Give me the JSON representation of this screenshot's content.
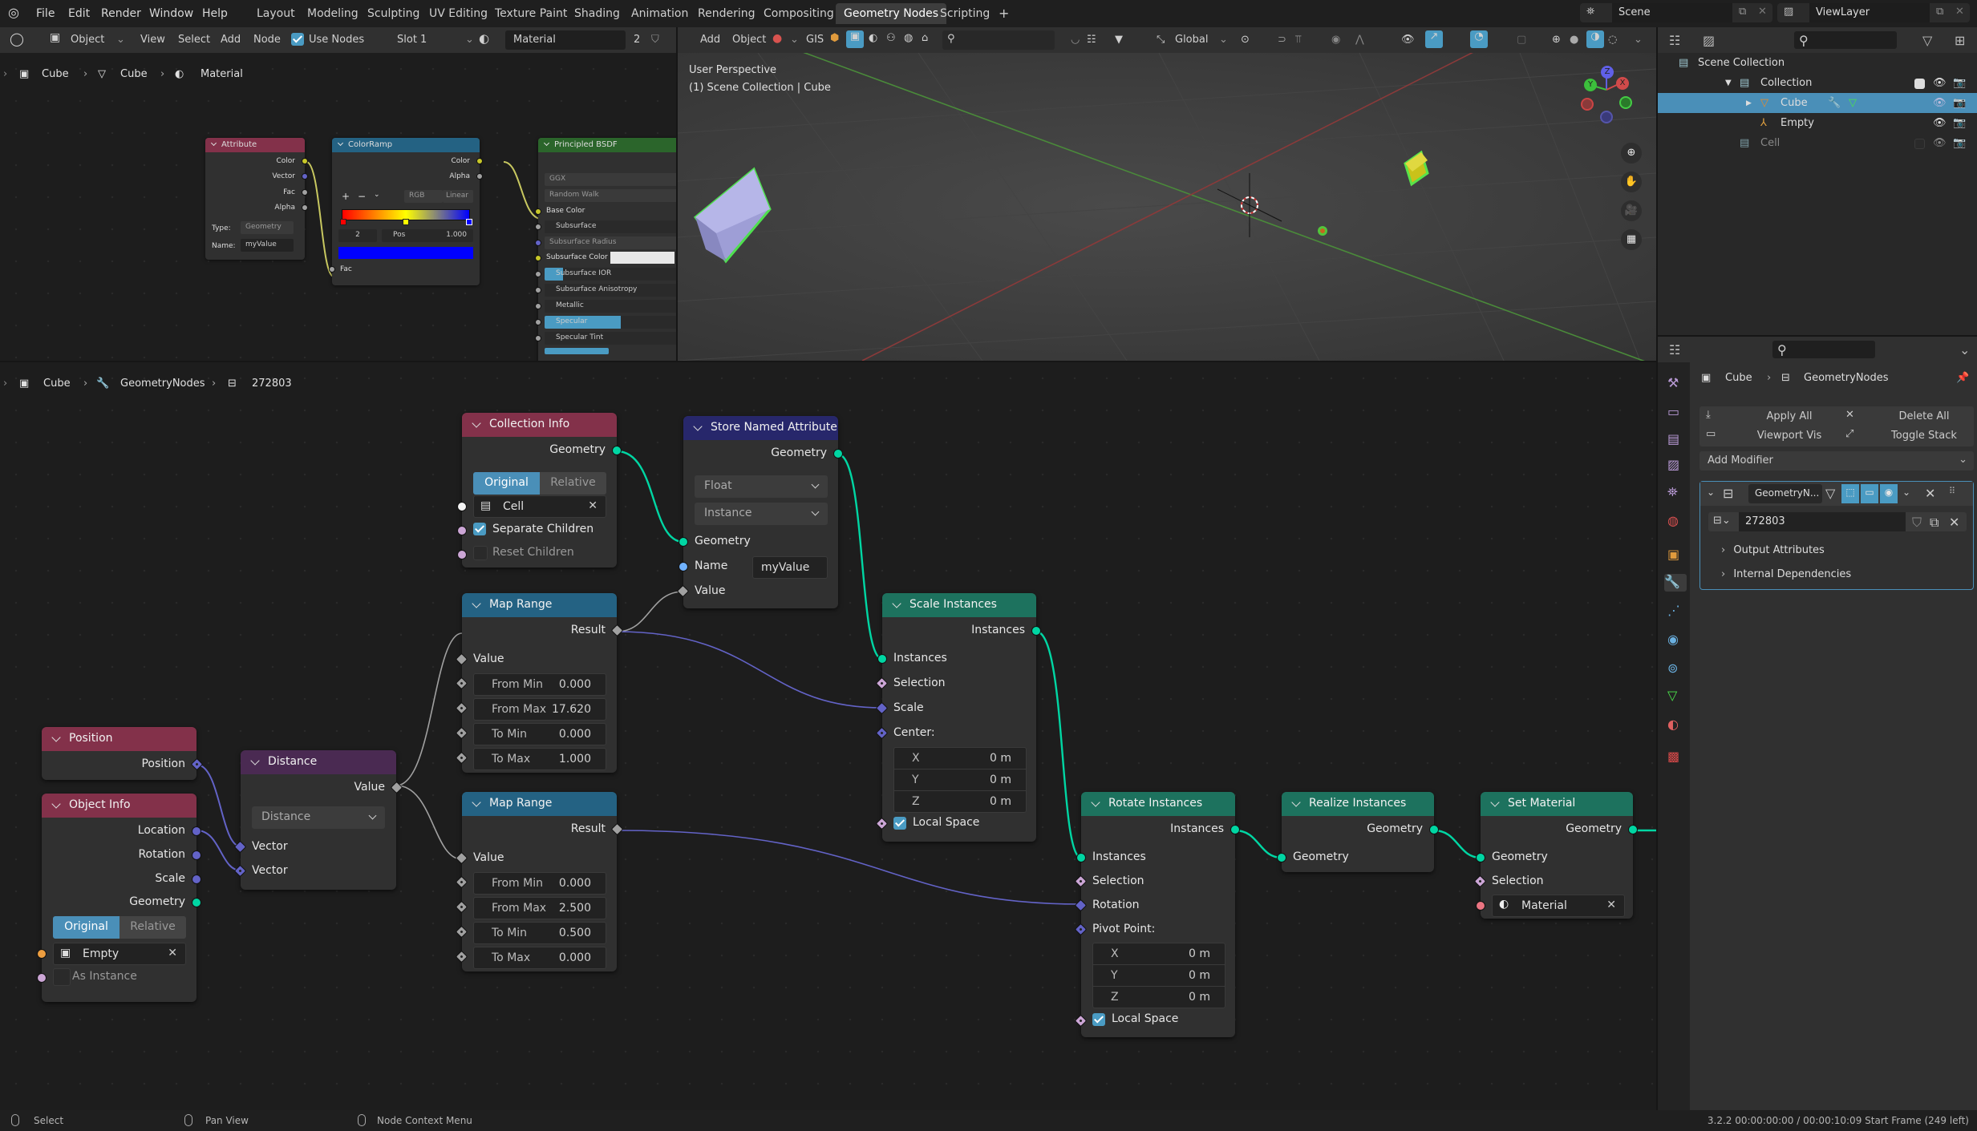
{
  "menubar": {
    "items": [
      "File",
      "Edit",
      "Render",
      "Window",
      "Help"
    ],
    "workspaces": [
      "Layout",
      "Modeling",
      "Sculpting",
      "UV Editing",
      "Texture Paint",
      "Shading",
      "Animation",
      "Rendering",
      "Compositing",
      "Geometry Nodes",
      "Scripting"
    ],
    "active_workspace": "Geometry Nodes",
    "add_workspace": "+",
    "scene": "Scene",
    "view_layer": "ViewLayer"
  },
  "shader_header": {
    "mode": "Object",
    "view": "View",
    "select": "Select",
    "add": "Add",
    "node": "Node",
    "use_nodes_label": "Use Nodes",
    "use_nodes_checked": true,
    "slot": "Slot 1",
    "material": "Material",
    "users": "2"
  },
  "shader_breadcrumb": [
    "Cube",
    "Cube",
    "Material"
  ],
  "shader_nodes": {
    "attribute": {
      "title": "Attribute",
      "outputs": [
        "Color",
        "Vector",
        "Fac",
        "Alpha"
      ],
      "type_label": "Type:",
      "type_value": "Geometry",
      "name_label": "Name:",
      "name_value": "myValue"
    },
    "colorramp": {
      "title": "ColorRamp",
      "outputs": [
        "Color",
        "Alpha"
      ],
      "color_mode": "RGB",
      "interpolation": "Linear",
      "active_index": "2",
      "pos_label": "Pos",
      "pos_value": "1.000",
      "input": "Fac",
      "stops": [
        "#ff0000",
        "#ffff00",
        "#0000ff"
      ],
      "active_color": "#0000ff"
    },
    "principled": {
      "title": "Principled BSDF",
      "distribution": "GGX",
      "subsurface_method": "Random Walk",
      "inputs": [
        "Base Color",
        "Subsurface",
        "Subsurface Radius",
        "Subsurface Color",
        "Subsurface IOR",
        "Subsurface Anisotropy",
        "Metallic",
        "Specular",
        "Specular Tint"
      ]
    }
  },
  "viewport_header": {
    "add": "Add",
    "object": "Object",
    "gis": "GIS",
    "orientation": "Global"
  },
  "viewport": {
    "perspective": "User Perspective",
    "collection_info": "(1) Scene Collection | Cube",
    "gizmo_axes": [
      "X",
      "Y",
      "Z"
    ]
  },
  "outliner": {
    "root": "Scene Collection",
    "items": [
      {
        "name": "Collection",
        "level": 1,
        "expanded": true,
        "checked": true
      },
      {
        "name": "Cube",
        "level": 2,
        "selected": true
      },
      {
        "name": "Empty",
        "level": 2
      },
      {
        "name": "Cell",
        "level": 1,
        "checked": false,
        "dimmed": true
      }
    ]
  },
  "geo_breadcrumb": [
    "Cube",
    "GeometryNodes",
    "272803"
  ],
  "geo_nodes": {
    "position": {
      "title": "Position",
      "output": "Position"
    },
    "object_info": {
      "title": "Object Info",
      "outputs": [
        "Location",
        "Rotation",
        "Scale",
        "Geometry"
      ],
      "transform_options": [
        "Original",
        "Relative"
      ],
      "transform_active": "Original",
      "object": "Empty",
      "as_instance_label": "As Instance",
      "as_instance": false
    },
    "distance": {
      "title": "Distance",
      "output": "Value",
      "operation": "Distance",
      "inputs": [
        "Vector",
        "Vector"
      ]
    },
    "collection_info": {
      "title": "Collection Info",
      "output": "Geometry",
      "transform_options": [
        "Original",
        "Relative"
      ],
      "transform_active": "Original",
      "collection": "Cell",
      "separate_children_label": "Separate Children",
      "separate_children": true,
      "reset_children_label": "Reset Children",
      "reset_children": false
    },
    "map_range_1": {
      "title": "Map Range",
      "output": "Result",
      "input": "Value",
      "fields": [
        {
          "label": "From Min",
          "value": "0.000"
        },
        {
          "label": "From Max",
          "value": "17.620"
        },
        {
          "label": "To Min",
          "value": "0.000"
        },
        {
          "label": "To Max",
          "value": "1.000"
        }
      ]
    },
    "map_range_2": {
      "title": "Map Range",
      "output": "Result",
      "input": "Value",
      "fields": [
        {
          "label": "From Min",
          "value": "0.000"
        },
        {
          "label": "From Max",
          "value": "2.500"
        },
        {
          "label": "To Min",
          "value": "0.500"
        },
        {
          "label": "To Max",
          "value": "0.000"
        }
      ]
    },
    "store_named_attribute": {
      "title": "Store Named Attribute",
      "output": "Geometry",
      "data_type": "Float",
      "domain": "Instance",
      "inputs": [
        "Geometry",
        "Name",
        "Value"
      ],
      "name_value": "myValue"
    },
    "scale_instances": {
      "title": "Scale Instances",
      "output": "Instances",
      "inputs": [
        "Instances",
        "Selection",
        "Scale",
        "Center:"
      ],
      "center": [
        {
          "axis": "X",
          "value": "0 m"
        },
        {
          "axis": "Y",
          "value": "0 m"
        },
        {
          "axis": "Z",
          "value": "0 m"
        }
      ],
      "local_space_label": "Local Space",
      "local_space": true
    },
    "rotate_instances": {
      "title": "Rotate Instances",
      "output": "Instances",
      "inputs": [
        "Instances",
        "Selection",
        "Rotation",
        "Pivot Point:"
      ],
      "pivot": [
        {
          "axis": "X",
          "value": "0 m"
        },
        {
          "axis": "Y",
          "value": "0 m"
        },
        {
          "axis": "Z",
          "value": "0 m"
        }
      ],
      "local_space_label": "Local Space",
      "local_space": true
    },
    "realize_instances": {
      "title": "Realize Instances",
      "output": "Geometry",
      "input": "Geometry"
    },
    "set_material": {
      "title": "Set Material",
      "output": "Geometry",
      "inputs": [
        "Geometry",
        "Selection"
      ],
      "material": "Material"
    }
  },
  "properties": {
    "breadcrumb": [
      "Cube",
      "GeometryNodes"
    ],
    "apply_all": "Apply All",
    "delete_all": "Delete All",
    "viewport_vis": "Viewport Vis",
    "toggle_stack": "Toggle Stack",
    "add_modifier": "Add Modifier",
    "modifier_name": "GeometryN...",
    "node_group": "272803",
    "panels": [
      "Output Attributes",
      "Internal Dependencies"
    ]
  },
  "status_bar": {
    "hints": [
      "Select",
      "Pan View",
      "Node Context Menu"
    ],
    "info": "3.2.2  00:00:00:00 / 00:00:10:09  Start Frame (249 left)"
  },
  "colors": {
    "accent": "#4a9bc3",
    "geometry_socket": "#00d6a3",
    "input_header": "#83314a",
    "function_header": "#246283",
    "geometry_header": "#1d725e",
    "attribute_header": "#27276b",
    "vector_header": "#4a2a52",
    "shader_header": "#2b652b"
  }
}
